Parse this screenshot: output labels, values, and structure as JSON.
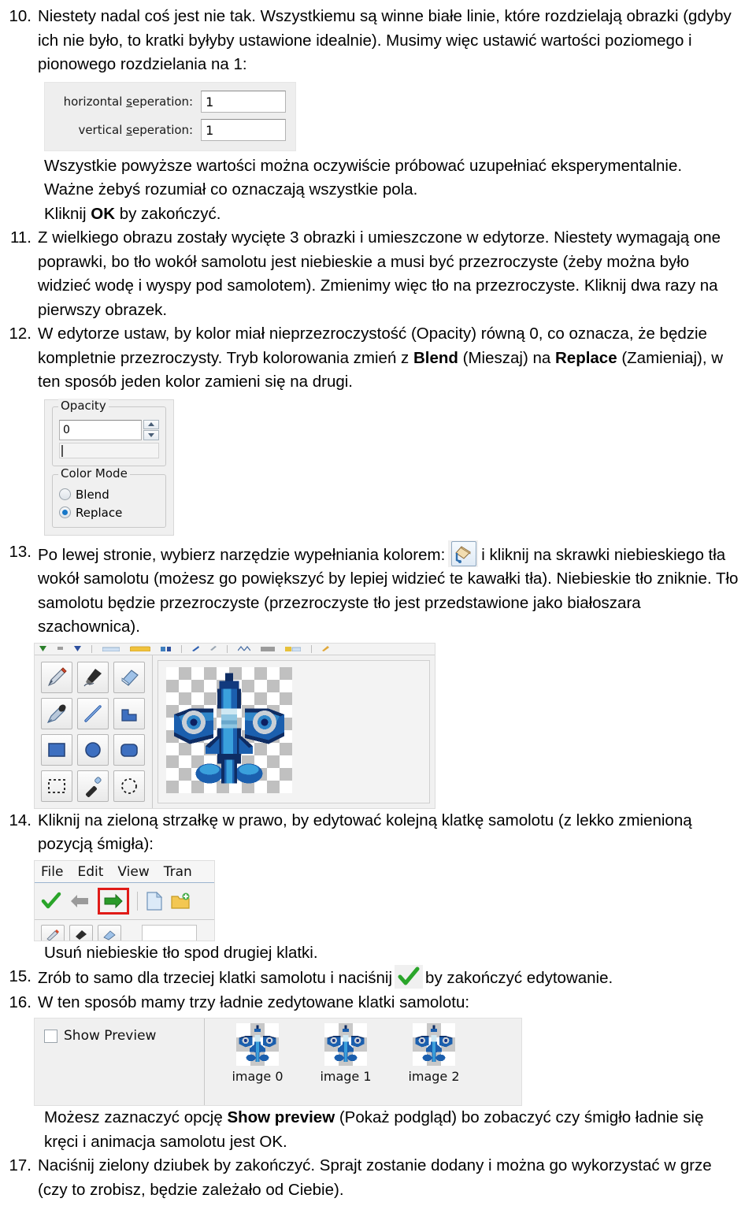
{
  "document": {
    "items": [
      {
        "num": "10.",
        "parts": [
          {
            "t": "Niestety nadal coś jest nie tak. Wszystkiemu są winne białe linie, które rozdzielają obrazki (gdyby ich nie było, to kratki byłyby ustawione idealnie). Musimy więc ustawić wartości poziomego i pionowego rozdzielania na 1:"
          }
        ]
      },
      {
        "num": "11.",
        "parts": [
          {
            "t": "Z wielkiego obrazu zostały wycięte 3 obrazki i umieszczone w edytorze. Niestety wymagają one poprawki, bo tło wokół samolotu jest niebieskie a musi być przezroczyste (żeby można było widzieć wodę i wyspy pod samolotem). Zmienimy więc tło na przezroczyste. Kliknij dwa razy na pierwszy obrazek."
          }
        ]
      },
      {
        "num": "12.",
        "parts": []
      },
      {
        "num": "13.",
        "parts": []
      },
      {
        "num": "14.",
        "parts": [
          {
            "t": "Kliknij na zieloną strzałkę w prawo, by edytować kolejną klatkę samolotu (z lekko zmienioną pozycją śmigła):"
          }
        ]
      },
      {
        "num": "15.",
        "parts": []
      },
      {
        "num": "16.",
        "parts": [
          {
            "t": "W ten sposób mamy trzy ładnie zedytowane klatki samolotu:"
          }
        ]
      },
      {
        "num": "17.",
        "parts": [
          {
            "t": "Naciśnij zielony dziubek by zakończyć. Sprajt zostanie dodany i można go wykorzystać w grze (czy to zrobisz, będzie zależało od Ciebie)."
          }
        ]
      }
    ],
    "paragraphs": {
      "after_sep_dialog_1": "Wszystkie powyższe wartości można oczywiście próbować uzupełniać eksperymentalnie.",
      "after_sep_dialog_2": "Ważne żebyś rozumiał co oznaczają wszystkie pola.",
      "ok_line_pre": "Kliknij ",
      "ok_line_bold": "OK",
      "ok_line_post": " by zakończyć.",
      "item12_pre": "W edytorze ustaw, by kolor miał nieprzezroczystość (Opacity) równą 0, co oznacza, że będzie kompletnie przezroczysty. Tryb kolorowania zmień z ",
      "item12_bold1": "Blend",
      "item12_mid": " (Mieszaj) na ",
      "item12_bold2": "Replace",
      "item12_post": " (Zamieniaj), w ten sposób jeden kolor zamieni się na drugi.",
      "item13_pre": "Po lewej stronie, wybierz narzędzie wypełniania kolorem:",
      "item13_post": "i kliknij na skrawki niebieskiego tła wokół samolotu (możesz go powiększyć by lepiej widzieć te kawałki tła). Niebieskie tło zniknie. Tło samolotu będzie przezroczyste (przezroczyste tło jest przedstawione jako białoszara szachownica).",
      "after_menu_shot": "Usuń niebieskie tło spod drugiej klatki.",
      "item15_pre": "Zrób to samo dla trzeciej klatki samolotu i naciśnij",
      "item15_post": "by zakończyć edytowanie.",
      "after_preview_pre": "Możesz zaznaczyć opcję ",
      "after_preview_bold": "Show preview",
      "after_preview_post": " (Pokaż podgląd) bo zobaczyć czy śmigło ładnie się kręci i animacja samolotu jest OK."
    }
  },
  "separation_dialog": {
    "rows": [
      {
        "label_pre": "horizontal ",
        "label_accel": "s",
        "label_post": "eperation:",
        "value": "1"
      },
      {
        "label_pre": "vertical ",
        "label_accel": "s",
        "label_post": "eperation:",
        "value": "1"
      }
    ]
  },
  "opacity_dialog": {
    "opacity_group_title": "Opacity",
    "opacity_value": "0",
    "color_mode_group_title": "Color Mode",
    "radios": [
      {
        "label": "Blend",
        "checked": false
      },
      {
        "label": "Replace",
        "checked": true
      }
    ]
  },
  "editor": {
    "tools": [
      "pencil-tool",
      "brush-tool",
      "eraser-tool",
      "eyedropper-tool",
      "line-tool",
      "fill-tool",
      "rectangle-tool",
      "ellipse-tool",
      "rounded-rect-tool",
      "rect-select-tool",
      "magic-wand-tool",
      "ellipse-select-tool"
    ]
  },
  "menu_shot": {
    "menus": [
      "File",
      "Edit",
      "View",
      "Tran"
    ],
    "toolbar_buttons": [
      "confirm-check-icon",
      "previous-frame-arrow-icon",
      "next-frame-arrow-icon",
      "new-file-icon",
      "open-folder-icon"
    ],
    "highlight_color": "#e01b18"
  },
  "preview_panel": {
    "checkbox_label": "Show Preview",
    "checkbox_checked": false,
    "frames": [
      {
        "label": "image 0"
      },
      {
        "label": "image 1"
      },
      {
        "label": "image 2"
      }
    ]
  },
  "colors": {
    "plane_dark": "#0b2a6b",
    "plane_mid": "#1f5fbd",
    "plane_light": "#3fa9e0",
    "plane_highlight": "#9fd6ef",
    "green_arrow": "#22a12b",
    "grey_arrow": "#9a9a9a",
    "highlight_red": "#e01b18",
    "accent_blue": "#1878c8"
  }
}
